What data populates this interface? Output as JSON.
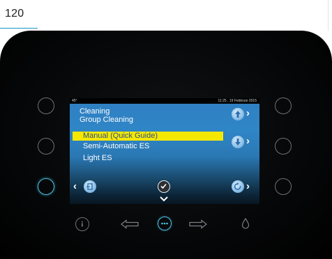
{
  "page": {
    "number": "120"
  },
  "display": {
    "status_left": "45°",
    "status_right": "11:25 , 19 Febbraio 2015",
    "title": "Cleaning",
    "subtitle": "Group Cleaning",
    "menu_items": [
      {
        "label": "Manual (Quick Guide)",
        "selected": true
      },
      {
        "label": "Semi-Automatic ES",
        "selected": false
      },
      {
        "label": "Light ES",
        "selected": false
      }
    ],
    "icons": {
      "up": "arrow-up-icon",
      "down": "arrow-down-icon",
      "back": "exit-door-icon",
      "confirm": "checkmark-icon",
      "refresh": "refresh-icon"
    }
  },
  "bottom_controls": {
    "icons": [
      "info-icon",
      "arrow-left-icon",
      "more-dots-icon",
      "arrow-right-icon",
      "water-drop-icon"
    ]
  },
  "colors": {
    "accent": "#49c3e8",
    "selection": "#f5e800",
    "selection_text": "#2a4f93",
    "screen_blue": "#2f7ec1"
  }
}
